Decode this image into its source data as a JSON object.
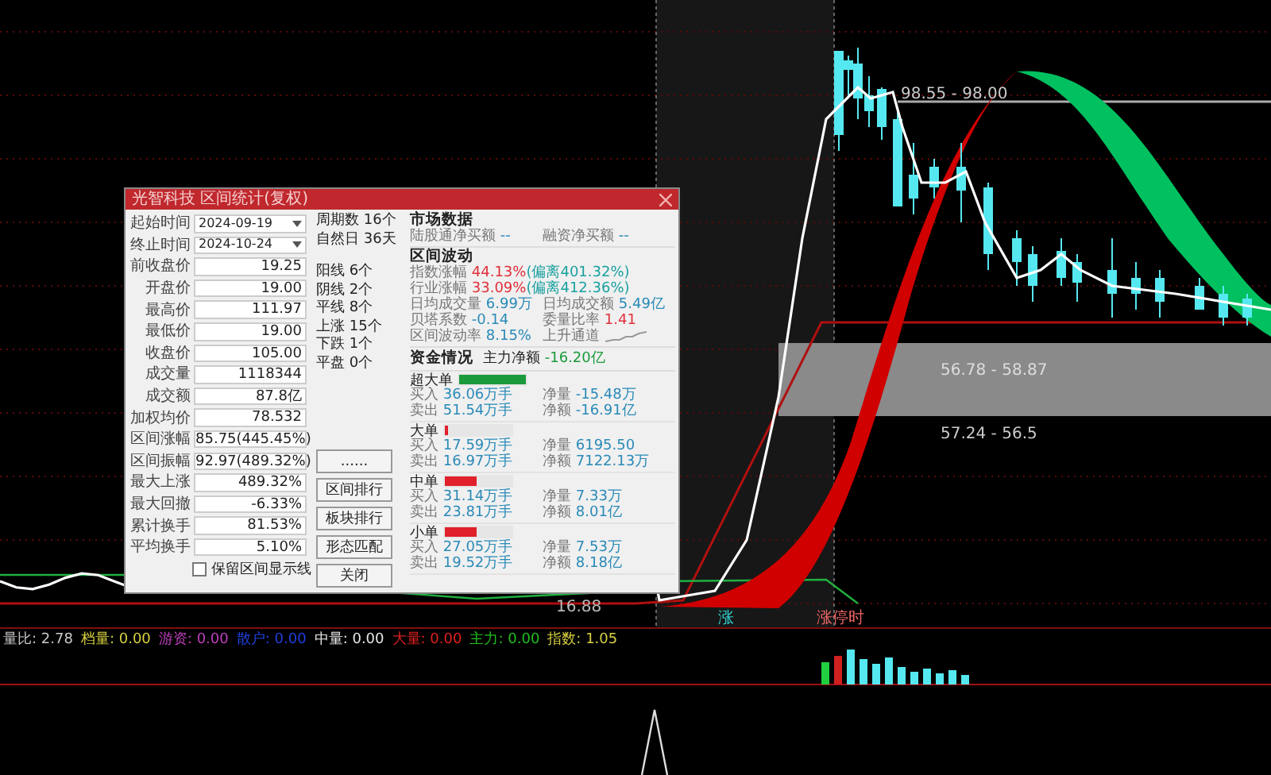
{
  "chart": {
    "labels": [
      {
        "text": "98.55 - 98.00"
      },
      {
        "text": "56.78 - 58.87"
      },
      {
        "text": "57.24 - 56.5"
      },
      {
        "text": "16.88"
      },
      {
        "text": "涨"
      },
      {
        "text": "涨停时"
      }
    ]
  },
  "dialog": {
    "title": "光智科技 区间统计(复权)",
    "fields": [
      {
        "label": "起始时间",
        "value": "2024-09-19",
        "kind": "dropdown"
      },
      {
        "label": "终止时间",
        "value": "2024-10-24",
        "kind": "dropdown"
      },
      {
        "label": "前收盘价",
        "value": "19.25",
        "kind": "text"
      },
      {
        "label": "开盘价",
        "value": "19.00",
        "kind": "text"
      },
      {
        "label": "最高价",
        "value": "111.97",
        "kind": "text"
      },
      {
        "label": "最低价",
        "value": "19.00",
        "kind": "text"
      },
      {
        "label": "收盘价",
        "value": "105.00",
        "kind": "text"
      },
      {
        "label": "成交量",
        "value": "1118344",
        "kind": "text"
      },
      {
        "label": "成交额",
        "value": "87.8亿",
        "kind": "text"
      },
      {
        "label": "加权均价",
        "value": "78.532",
        "kind": "text"
      },
      {
        "label": "区间涨幅",
        "value": "85.75(445.45%)",
        "kind": "text"
      },
      {
        "label": "区间振幅",
        "value": "92.97(489.32%)",
        "kind": "text"
      },
      {
        "label": "最大上涨",
        "value": "489.32%",
        "kind": "text"
      },
      {
        "label": "最大回撤",
        "value": "-6.33%",
        "kind": "text"
      },
      {
        "label": "累计换手",
        "value": "81.53%",
        "kind": "text"
      },
      {
        "label": "平均换手",
        "value": "5.10%",
        "kind": "text"
      }
    ],
    "period_stats": [
      {
        "label": "周期数",
        "value": "16个"
      },
      {
        "label": "自然日",
        "value": "36天"
      }
    ],
    "candle_stats": [
      {
        "label": "阳线",
        "value": "6个"
      },
      {
        "label": "阴线",
        "value": "2个"
      },
      {
        "label": "平线",
        "value": "8个"
      },
      {
        "label": "上涨",
        "value": "15个"
      },
      {
        "label": "下跌",
        "value": "1个"
      },
      {
        "label": "平盘",
        "value": "0个"
      }
    ],
    "buttons": [
      "......",
      "区间排行",
      "板块排行",
      "形态匹配",
      "关闭"
    ],
    "checkbox": {
      "label": "保留区间显示线",
      "checked": false
    },
    "market": {
      "heading": "市场数据",
      "items": [
        {
          "label": "陆股通净买额",
          "value": "--"
        },
        {
          "label": "融资净买额",
          "value": "--"
        }
      ]
    },
    "volatility": {
      "heading": "区间波动",
      "items": [
        {
          "kind": "wide",
          "label": "指数涨幅",
          "value": "44.13%",
          "note": "(偏离401.32%)",
          "color": "#e0303a"
        },
        {
          "kind": "wide",
          "label": "行业涨幅",
          "value": "33.09%",
          "note": "(偏离412.36%)",
          "color": "#e0303a"
        },
        {
          "kind": "half",
          "label": "日均成交量",
          "value": "6.99万",
          "color": "#2a8ab8"
        },
        {
          "kind": "half",
          "label": "日均成交额",
          "value": "5.49亿",
          "color": "#2a8ab8"
        },
        {
          "kind": "half",
          "label": "贝塔系数",
          "value": "-0.14",
          "color": "#2a8ab8"
        },
        {
          "kind": "half",
          "label": "委量比率",
          "value": "1.41",
          "color": "#e0303a"
        },
        {
          "kind": "half",
          "label": "区间波动率",
          "value": "8.15%",
          "color": "#2a8ab8"
        },
        {
          "kind": "trend",
          "label": "上升通道"
        }
      ]
    },
    "funds": {
      "heading": "资金情况",
      "main_label": "主力净额",
      "main_value": "-16.20亿",
      "groups": [
        {
          "name": "超大单",
          "color": "#1a9a3a",
          "level": 1,
          "rows": [
            {
              "label": "买入",
              "value": "36.06万手",
              "label2": "净量",
              "value2": "-15.48万"
            },
            {
              "label": "卖出",
              "value": "51.54万手",
              "label2": "净额",
              "value2": "-16.91亿"
            }
          ]
        },
        {
          "name": "大单",
          "color": "#e0202a",
          "level": 0.04,
          "rows": [
            {
              "label": "买入",
              "value": "17.59万手",
              "label2": "净量",
              "value2": "6195.50"
            },
            {
              "label": "卖出",
              "value": "16.97万手",
              "label2": "净额",
              "value2": "7122.13万"
            }
          ]
        },
        {
          "name": "中单",
          "color": "#e0202a",
          "level": 0.48,
          "rows": [
            {
              "label": "买入",
              "value": "31.14万手",
              "label2": "净量",
              "value2": "7.33万"
            },
            {
              "label": "卖出",
              "value": "23.81万手",
              "label2": "净额",
              "value2": "8.01亿"
            }
          ]
        },
        {
          "name": "小单",
          "color": "#e0202a",
          "level": 0.48,
          "rows": [
            {
              "label": "买入",
              "value": "27.05万手",
              "label2": "净量",
              "value2": "7.53万"
            },
            {
              "label": "卖出",
              "value": "19.52万手",
              "label2": "净额",
              "value2": "8.18亿"
            }
          ]
        }
      ]
    }
  },
  "indicators": [
    {
      "label": "量比:",
      "value": "2.78",
      "color": "#c8c8c8"
    },
    {
      "label": "档量:",
      "value": "0.00",
      "color": "#d8d040"
    },
    {
      "label": "游资:",
      "value": "0.00",
      "color": "#c040c0"
    },
    {
      "label": "散户:",
      "value": "0.00",
      "color": "#2040e0"
    },
    {
      "label": "中量:",
      "value": "0.00",
      "color": "#e8e8e8"
    },
    {
      "label": "大量:",
      "value": "0.00",
      "color": "#e02020"
    },
    {
      "label": "主力:",
      "value": "0.00",
      "color": "#20c020"
    },
    {
      "label": "指数:",
      "value": "1.05",
      "color": "#d8d040"
    }
  ]
}
